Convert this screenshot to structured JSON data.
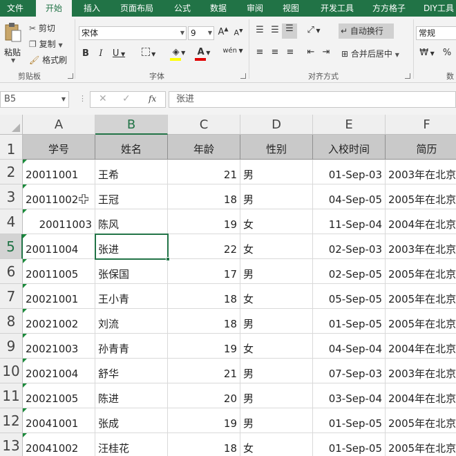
{
  "tabs": [
    "文件",
    "开始",
    "插入",
    "页面布局",
    "公式",
    "数据",
    "审阅",
    "视图",
    "开发工具",
    "方方格子",
    "DIY工具"
  ],
  "active_tab_index": 1,
  "clipboard": {
    "paste": "粘贴",
    "cut": "剪切",
    "copy": "复制",
    "format_painter": "格式刷",
    "group_label": "剪贴板"
  },
  "font": {
    "name": "宋体",
    "size": "9",
    "group_label": "字体",
    "bold": "B",
    "italic": "I",
    "underline": "U"
  },
  "alignment": {
    "wrap_text": "自动换行",
    "merge_center": "合并后居中",
    "group_label": "对齐方式"
  },
  "number": {
    "format": "常规",
    "percent": "%",
    "group_label": "数"
  },
  "formula_bar": {
    "name_box": "B5",
    "fx": "fx",
    "value": "张进"
  },
  "columns": [
    "A",
    "B",
    "C",
    "D",
    "E",
    "F"
  ],
  "selected_column": "B",
  "selected_row": "5",
  "header_row": [
    "学号",
    "姓名",
    "年龄",
    "性别",
    "入校时间",
    "简历"
  ],
  "rows": [
    [
      "2",
      "20011001",
      "王希",
      "21",
      "男",
      "01-Sep-03",
      "2003年在北京"
    ],
    [
      "3",
      "20011002",
      "王冠",
      "18",
      "男",
      "04-Sep-05",
      "2005年在北京"
    ],
    [
      "4",
      "20011003",
      "陈风",
      "19",
      "女",
      "11-Sep-04",
      "2004年在北京"
    ],
    [
      "5",
      "20011004",
      "张进",
      "22",
      "女",
      "02-Sep-03",
      "2003年在北京"
    ],
    [
      "6",
      "20011005",
      "张保国",
      "17",
      "男",
      "02-Sep-05",
      "2005年在北京"
    ],
    [
      "7",
      "20021001",
      "王小青",
      "18",
      "女",
      "05-Sep-05",
      "2005年在北京"
    ],
    [
      "8",
      "20021002",
      "刘流",
      "18",
      "男",
      "01-Sep-05",
      "2005年在北京"
    ],
    [
      "9",
      "20021003",
      "孙青青",
      "19",
      "女",
      "04-Sep-04",
      "2004年在北京"
    ],
    [
      "10",
      "20021004",
      "舒华",
      "21",
      "男",
      "07-Sep-03",
      "2003年在北京"
    ],
    [
      "11",
      "20021005",
      "陈进",
      "20",
      "男",
      "03-Sep-04",
      "2004年在北京"
    ],
    [
      "12",
      "20041001",
      "张成",
      "19",
      "男",
      "01-Sep-05",
      "2005年在北京"
    ],
    [
      "13",
      "20041002",
      "汪桂花",
      "18",
      "女",
      "01-Sep-05",
      "2005年在北京"
    ]
  ],
  "right_aligned_id_row": "4",
  "colors": {
    "accent": "#217346",
    "header_fill": "#c9c9c9",
    "error_triangle": "#1a8a3a"
  }
}
